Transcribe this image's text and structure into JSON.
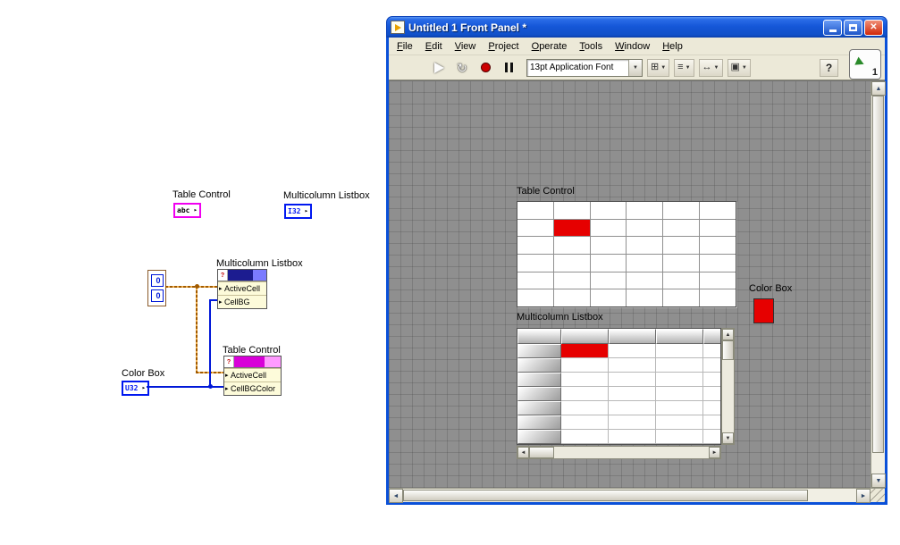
{
  "colors": {
    "red": "#e60000",
    "wire_cluster": "#a05a00",
    "wire_blue": "#0018d8",
    "terminal_pink": "#f000f0",
    "terminal_blue": "#0018f0",
    "node1_ribbon": [
      "#1c1c90",
      "#7a7aff"
    ],
    "node2_ribbon": [
      "#d800d8",
      "#ff9aff"
    ]
  },
  "window": {
    "title": "Untitled 1 Front Panel *",
    "menu": [
      "File",
      "Edit",
      "View",
      "Project",
      "Operate",
      "Tools",
      "Window",
      "Help"
    ],
    "toolbar": {
      "font_selector": "13pt Application Font",
      "help": "?",
      "badge": "1"
    }
  },
  "front_panel": {
    "table": {
      "label": "Table Control",
      "rows": 6,
      "cols": 6,
      "red_cell": {
        "row": 1,
        "col": 1
      }
    },
    "color_box": {
      "label": "Color Box"
    },
    "listbox": {
      "label": "Multicolumn Listbox",
      "rows": 7,
      "cols": 4,
      "red_cell": {
        "row": 0,
        "col": 0
      }
    }
  },
  "block_diagram": {
    "table_terminal": {
      "label": "Table Control",
      "text": "abc"
    },
    "listbox_terminal": {
      "label": "Multicolumn Listbox",
      "text": "I32"
    },
    "color_terminal": {
      "label": "Color Box",
      "text": "U32"
    },
    "cluster_constant": {
      "values": [
        "0",
        "0"
      ]
    },
    "property_nodes": [
      {
        "label": "Multicolumn Listbox",
        "rows": [
          "ActiveCell",
          "CellBG"
        ]
      },
      {
        "label": "Table Control",
        "rows": [
          "ActiveCell",
          "CellBGColor"
        ]
      }
    ]
  }
}
